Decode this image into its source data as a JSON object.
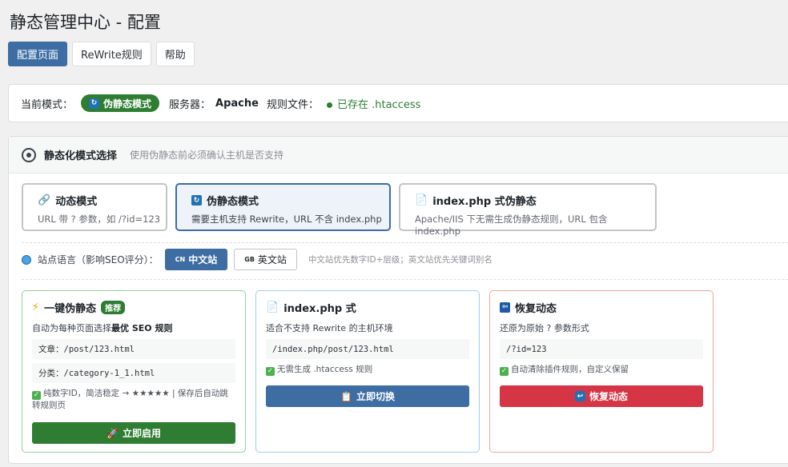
{
  "header": {
    "title": "静态管理中心 - 配置"
  },
  "tabs": [
    {
      "label": "配置页面"
    },
    {
      "label": "ReWrite规则"
    },
    {
      "label": "帮助"
    }
  ],
  "status": {
    "mode_label": "当前模式：",
    "mode_value": "伪静态模式",
    "server_label": "服务器：",
    "server_value": "Apache",
    "rules_label": "规则文件：",
    "rules_value": "已存在 .htaccess"
  },
  "section": {
    "title": "静态化模式选择",
    "subtitle": "使用伪静态前必须确认主机是否支持"
  },
  "modes": [
    {
      "title": "动态模式",
      "desc": "URL 带 ? 参数，如 /?id=123",
      "icon": "link-icon"
    },
    {
      "title": "伪静态模式",
      "desc": "需要主机支持 Rewrite，URL 不含 index.php",
      "icon": "refresh-icon"
    },
    {
      "title": "index.php 式伪静态",
      "desc": "Apache/IIS 下无需生成伪静态规则，URL 包含 index.php",
      "icon": "file-icon"
    }
  ],
  "language": {
    "label": "站点语言（影响SEO评分）：",
    "cn_code": "CN",
    "cn_label": "中文站",
    "en_code": "GB",
    "en_label": "英文站",
    "hint": "中文站优先数字ID+层级；英文站优先关键词别名"
  },
  "options": {
    "one_click": {
      "title": "一键伪静态",
      "badge": "推荐",
      "desc_prefix": "自动为每种页面选择",
      "desc_bold": "最优 SEO 规则",
      "code1": "文章：/post/123.html",
      "code2": "分类：/category-1_1.html",
      "note": "纯数字ID，简洁稳定 → ★★★★★ | 保存后自动跳转规则页",
      "button": "立即启用"
    },
    "index_php": {
      "title": "index.php 式",
      "desc": "适合不支持 Rewrite 的主机环境",
      "code": "/index.php/post/123.html",
      "note": "无需生成 .htaccess 规则",
      "button": "立即切换"
    },
    "restore": {
      "title": "恢复动态",
      "desc": "还原为原始 ? 参数形式",
      "code": "/?id=123",
      "note": "自动清除插件规则，自定义保留",
      "button": "恢复动态"
    }
  },
  "colors": {
    "primary": "#3d6da3",
    "success": "#2e7d32",
    "danger": "#d63545",
    "card_green_border": "#8fd19e",
    "card_blue_border": "#9ecfe8",
    "card_red_border": "#f0a5a5"
  }
}
